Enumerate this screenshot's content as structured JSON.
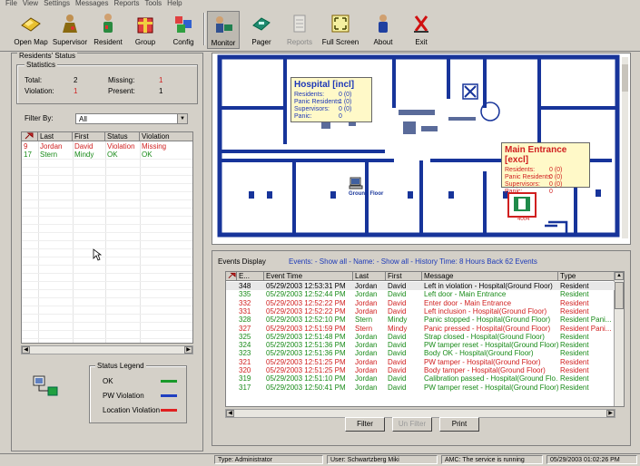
{
  "menubar": [
    "File",
    "View",
    "Settings",
    "Messages",
    "Reports",
    "Tools",
    "Help"
  ],
  "toolbar": [
    {
      "label": "Open Map",
      "icon": "open-map-icon"
    },
    {
      "label": "Supervisor",
      "icon": "supervisor-icon"
    },
    {
      "label": "Resident",
      "icon": "resident-icon"
    },
    {
      "label": "Group",
      "icon": "group-icon"
    },
    {
      "label": "Config",
      "icon": "config-icon"
    },
    {
      "label": "Monitor",
      "icon": "monitor-icon"
    },
    {
      "label": "Pager",
      "icon": "pager-icon"
    },
    {
      "label": "Reports",
      "icon": "reports-icon"
    },
    {
      "label": "Full Screen",
      "icon": "full-screen-icon"
    },
    {
      "label": "About",
      "icon": "about-icon"
    },
    {
      "label": "Exit",
      "icon": "exit-icon"
    }
  ],
  "residents_status": {
    "title": "Residents' Status",
    "statistics_label": "Statistics",
    "total_label": "Total:",
    "total_value": "2",
    "missing_label": "Missing:",
    "missing_value": "1",
    "violation_label": "Violation:",
    "violation_value": "1",
    "present_label": "Present:",
    "present_value": "1",
    "filter_label": "Filter By:",
    "filter_value": "All",
    "columns": [
      "Last",
      "First",
      "Status",
      "Violation"
    ],
    "rows": [
      {
        "id": "9",
        "last": "Jordan",
        "first": "David",
        "status": "Violation",
        "violation": "Missing",
        "color": "#d02020"
      },
      {
        "id": "17",
        "last": "Stern",
        "first": "Mindy",
        "status": "OK",
        "violation": "OK",
        "color": "#188a18"
      }
    ]
  },
  "legend": {
    "title": "Status Legend",
    "items": [
      {
        "label": "OK",
        "color": "#1a9a2a"
      },
      {
        "label": "PW Violation",
        "color": "#1f3fc0"
      },
      {
        "label": "Location Violation",
        "color": "#e02020"
      }
    ]
  },
  "map": {
    "hospital_popup": {
      "title": "Hospital [incl]",
      "rows": [
        {
          "label": "Residents:",
          "value": "0 (0)"
        },
        {
          "label": "Panic Residents:",
          "value": "1 (0)"
        },
        {
          "label": "Supervisors:",
          "value": "0 (0)"
        },
        {
          "label": "Panic:",
          "value": "0"
        }
      ]
    },
    "entrance_popup": {
      "title": "Main Entrance [excl]",
      "rows": [
        {
          "label": "Residents:",
          "value": "0 (0)"
        },
        {
          "label": "Panic Residents:",
          "value": "0 (0)"
        },
        {
          "label": "Supervisors:",
          "value": "0 (0)"
        },
        {
          "label": "Panic:",
          "value": "0"
        }
      ]
    },
    "floor_label": "Ground Floor",
    "door_label": "4004"
  },
  "events": {
    "title": "Events Display",
    "filter_summary": "Events: - Show all -   Name: - Show all -   History Time: 8 Hours Back   62 Events",
    "columns": [
      "E...",
      "Event Time",
      "Last",
      "First",
      "Message",
      "Type"
    ],
    "rows": [
      {
        "e": "348",
        "time": "05/29/2003 12:53:31 PM",
        "last": "Jordan",
        "first": "David",
        "msg": "Left in violation - Hospital(Ground Floor)",
        "type": "Resident",
        "color": "#000000"
      },
      {
        "e": "335",
        "time": "05/29/2003 12:52:44 PM",
        "last": "Jordan",
        "first": "David",
        "msg": "Left door - Main Entrance",
        "type": "Resident",
        "color": "#188a18"
      },
      {
        "e": "332",
        "time": "05/29/2003 12:52:22 PM",
        "last": "Jordan",
        "first": "David",
        "msg": "Enter door - Main Entrance",
        "type": "Resident",
        "color": "#d02020"
      },
      {
        "e": "331",
        "time": "05/29/2003 12:52:22 PM",
        "last": "Jordan",
        "first": "David",
        "msg": "Left inclusion - Hospital(Ground Floor)",
        "type": "Resident",
        "color": "#d02020"
      },
      {
        "e": "328",
        "time": "05/29/2003 12:52:10 PM",
        "last": "Stern",
        "first": "Mindy",
        "msg": "Panic stopped - Hospital(Ground Floor)",
        "type": "Resident Pani...",
        "color": "#188a18"
      },
      {
        "e": "327",
        "time": "05/29/2003 12:51:59 PM",
        "last": "Stern",
        "first": "Mindy",
        "msg": "Panic pressed - Hospital(Ground Floor)",
        "type": "Resident Pani...",
        "color": "#d02020"
      },
      {
        "e": "325",
        "time": "05/29/2003 12:51:48 PM",
        "last": "Jordan",
        "first": "David",
        "msg": "Strap closed - Hospital(Ground Floor)",
        "type": "Resident",
        "color": "#188a18"
      },
      {
        "e": "324",
        "time": "05/29/2003 12:51:36 PM",
        "last": "Jordan",
        "first": "David",
        "msg": "PW tamper reset - Hospital(Ground Floor)",
        "type": "Resident",
        "color": "#188a18"
      },
      {
        "e": "323",
        "time": "05/29/2003 12:51:36 PM",
        "last": "Jordan",
        "first": "David",
        "msg": "Body OK - Hospital(Ground Floor)",
        "type": "Resident",
        "color": "#188a18"
      },
      {
        "e": "321",
        "time": "05/29/2003 12:51:25 PM",
        "last": "Jordan",
        "first": "David",
        "msg": "PW tamper - Hospital(Ground Floor)",
        "type": "Resident",
        "color": "#d02020"
      },
      {
        "e": "320",
        "time": "05/29/2003 12:51:25 PM",
        "last": "Jordan",
        "first": "David",
        "msg": "Body tamper - Hospital(Ground Floor)",
        "type": "Resident",
        "color": "#d02020"
      },
      {
        "e": "319",
        "time": "05/29/2003 12:51:10 PM",
        "last": "Jordan",
        "first": "David",
        "msg": "Calibration passed - Hospital(Ground Flo...",
        "type": "Resident",
        "color": "#188a18"
      },
      {
        "e": "317",
        "time": "05/29/2003 12:50:41 PM",
        "last": "Jordan",
        "first": "David",
        "msg": "PW tamper reset - Hospital(Ground Floor)",
        "type": "Resident",
        "color": "#188a18"
      }
    ],
    "buttons": {
      "filter": "Filter",
      "unfilter": "Un Filter",
      "print": "Print"
    }
  },
  "statusbar": {
    "type": "Type: Administrator",
    "user": "User: Schwartzberg Miki",
    "amc": "AMC: The service is running",
    "datetime": "05/29/2003 01:02:26 PM"
  }
}
